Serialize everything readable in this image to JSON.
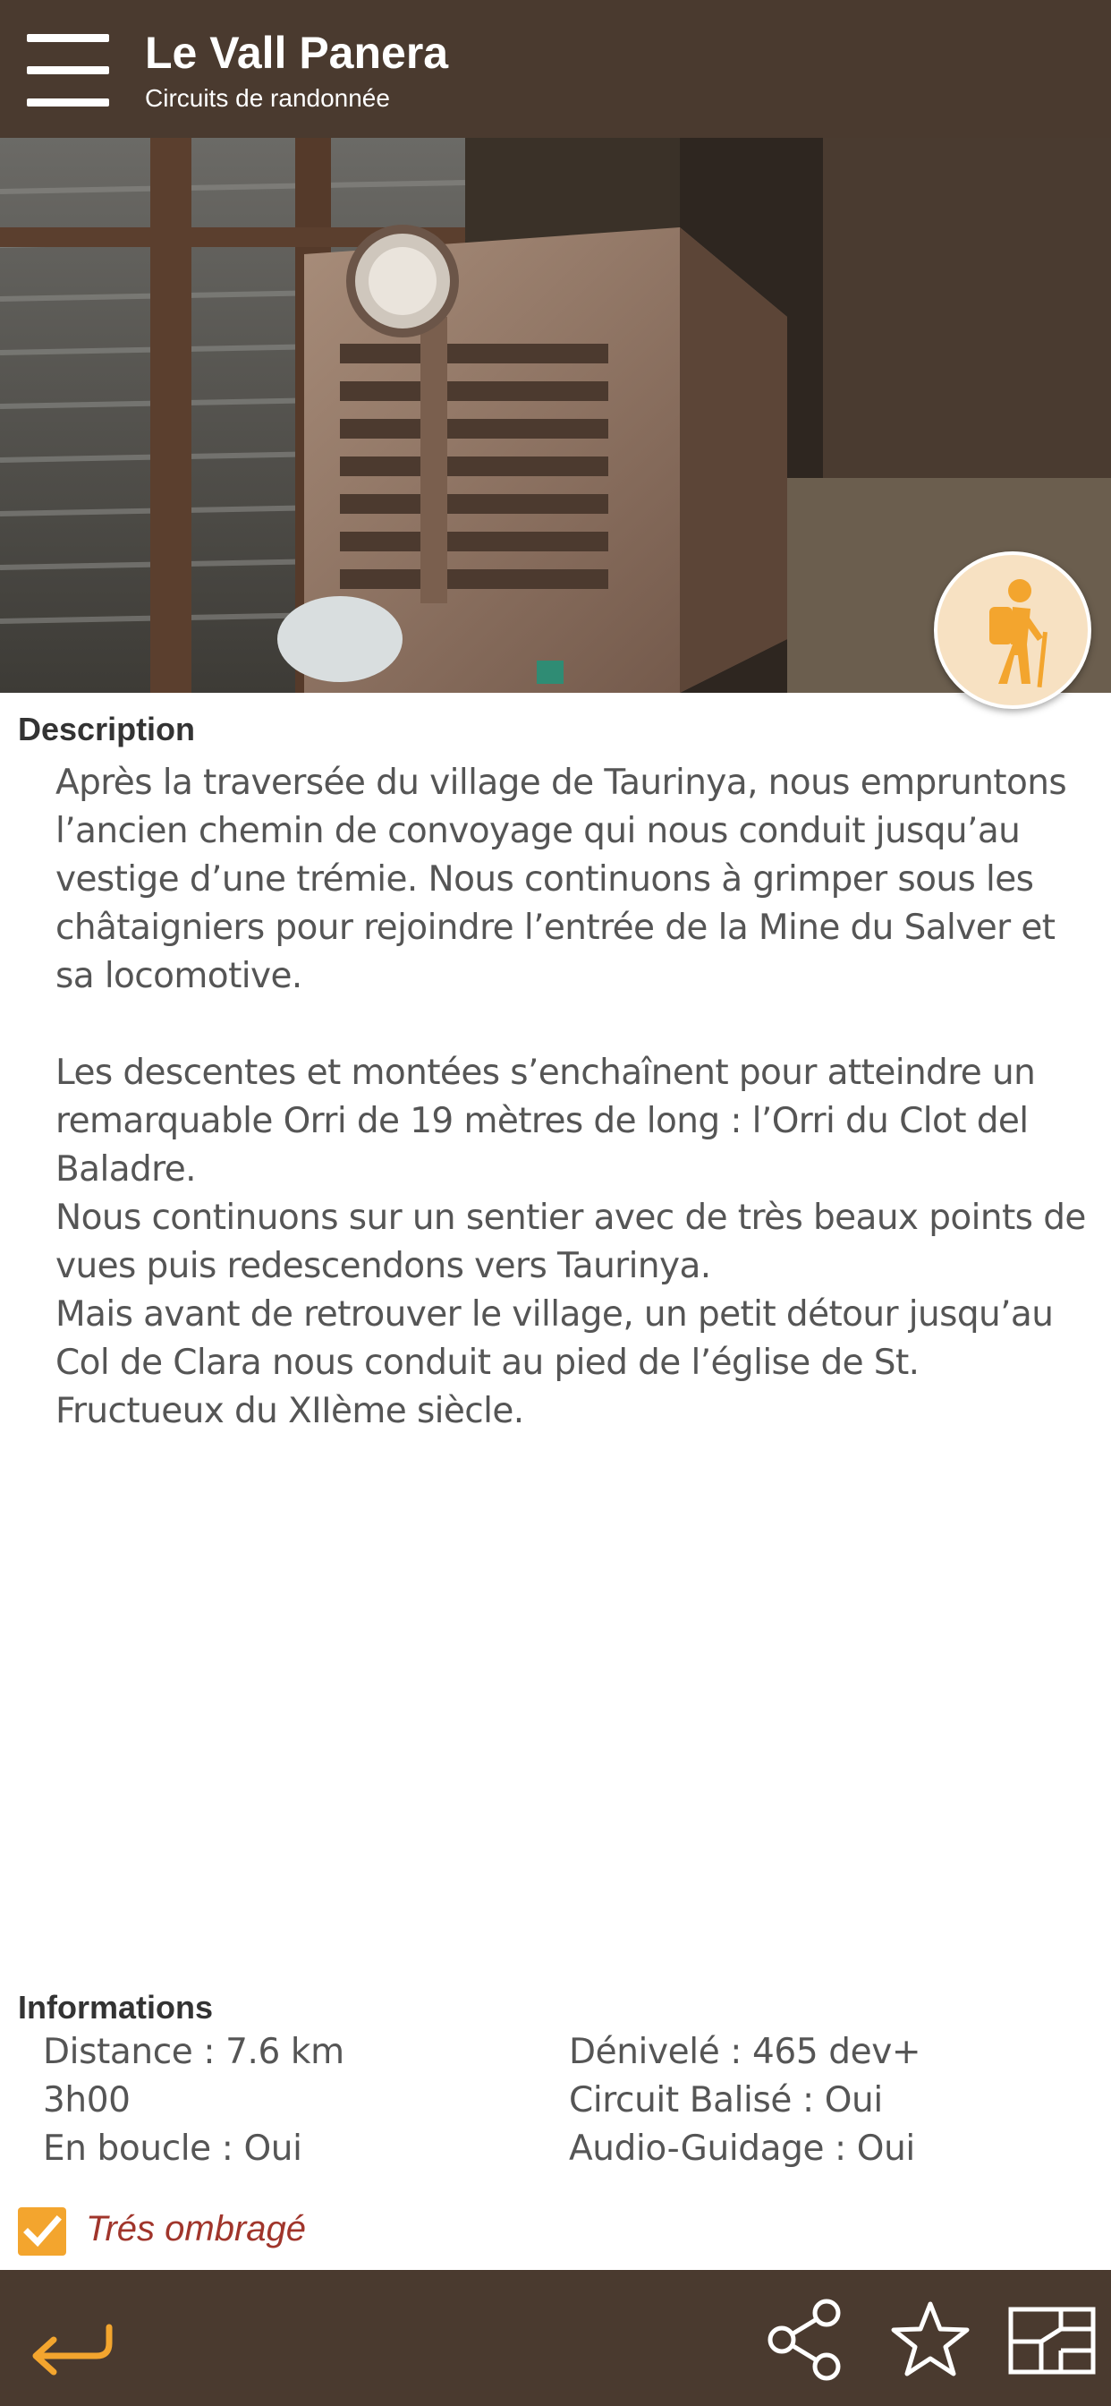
{
  "header": {
    "title": "Le Vall Panera",
    "subtitle": "Circuits de randonnée"
  },
  "hero": {
    "badge_icon": "hiker-icon",
    "badge_color": "#f3a52e"
  },
  "description": {
    "title": "Description",
    "paragraphs": [
      "Après la traversée du village de Taurinya, nous empruntons l’ancien chemin de convoyage qui nous conduit jusqu’au vestige d’une trémie. Nous continuons à grimper sous les châtaigniers pour rejoindre l’entrée de la Mine du Salver et sa locomotive.",
      "Les descentes et montées s’enchaînent pour atteindre un remarquable Orri de 19 mètres de long : l’Orri du Clot del Baladre.\nNous continuons sur un sentier avec de très beaux points de vues puis redescendons vers Taurinya.\nMais avant de retrouver le village, un petit détour jusqu’au Col de Clara nous conduit au pied de l’église de St. Fructueux du XIIème siècle."
    ]
  },
  "informations": {
    "title": "Informations",
    "distance": "Distance : 7.6 km",
    "duration": "3h00",
    "loop": "En boucle : Oui",
    "elevation": "Dénivelé : 465 dev+",
    "marked": "Circuit Balisé : Oui",
    "audio": "Audio-Guidage : Oui"
  },
  "shade": {
    "label": "Trés ombragé",
    "checked": true
  },
  "colors": {
    "bar": "#4a3a2f",
    "accent": "#f3a52e",
    "shade_text": "#a0352b"
  },
  "bottom_bar": {
    "icons": [
      "back-arrow-icon",
      "share-icon",
      "star-icon",
      "map-icon"
    ]
  }
}
